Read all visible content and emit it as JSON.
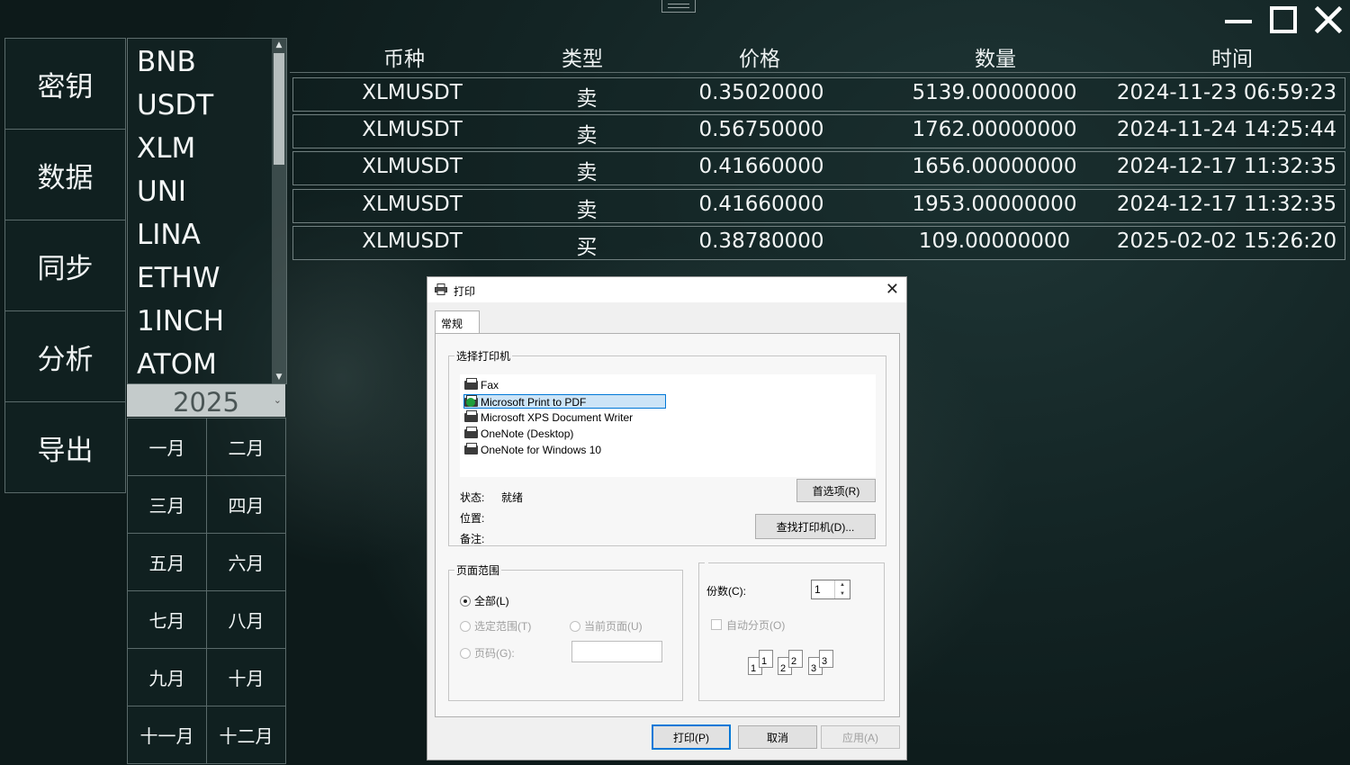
{
  "nav": [
    "密钥",
    "数据",
    "同步",
    "分析",
    "导出"
  ],
  "coins": [
    "BNB",
    "USDT",
    "XLM",
    "UNI",
    "LINA",
    "ETHW",
    "1INCH",
    "ATOM"
  ],
  "year": "2025",
  "months": [
    "一月",
    "二月",
    "三月",
    "四月",
    "五月",
    "六月",
    "七月",
    "八月",
    "九月",
    "十月",
    "十一月",
    "十二月"
  ],
  "table": {
    "headers": [
      "币种",
      "类型",
      "价格",
      "数量",
      "时间"
    ],
    "rows": [
      [
        "XLMUSDT",
        "卖",
        "0.35020000",
        "5139.00000000",
        "2024-11-23 06:59:23"
      ],
      [
        "XLMUSDT",
        "卖",
        "0.56750000",
        "1762.00000000",
        "2024-11-24 14:25:44"
      ],
      [
        "XLMUSDT",
        "卖",
        "0.41660000",
        "1656.00000000",
        "2024-12-17 11:32:35"
      ],
      [
        "XLMUSDT",
        "卖",
        "0.41660000",
        "1953.00000000",
        "2024-12-17 11:32:35"
      ],
      [
        "XLMUSDT",
        "买",
        "0.38780000",
        "109.00000000",
        "2025-02-02 15:26:20"
      ]
    ]
  },
  "dialog": {
    "title": "打印",
    "tab": "常规",
    "printer_group": "选择打印机",
    "printers": [
      "Fax",
      "Microsoft Print to PDF",
      "Microsoft XPS Document Writer",
      "OneNote (Desktop)",
      "OneNote for Windows 10"
    ],
    "selected_printer": "Microsoft Print to PDF",
    "status_label": "状态:",
    "status_value": "就绪",
    "location_label": "位置:",
    "comment_label": "备注:",
    "preferences_btn": "首选项(R)",
    "find_printer_btn": "查找打印机(D)...",
    "range_group": "页面范围",
    "all": "全部(L)",
    "selection": "选定范围(T)",
    "current_page": "当前页面(U)",
    "pages": "页码(G):",
    "copies_label": "份数(C):",
    "copies_value": "1",
    "collate": "自动分页(O)",
    "print_btn": "打印(P)",
    "cancel_btn": "取消",
    "apply_btn": "应用(A)"
  }
}
